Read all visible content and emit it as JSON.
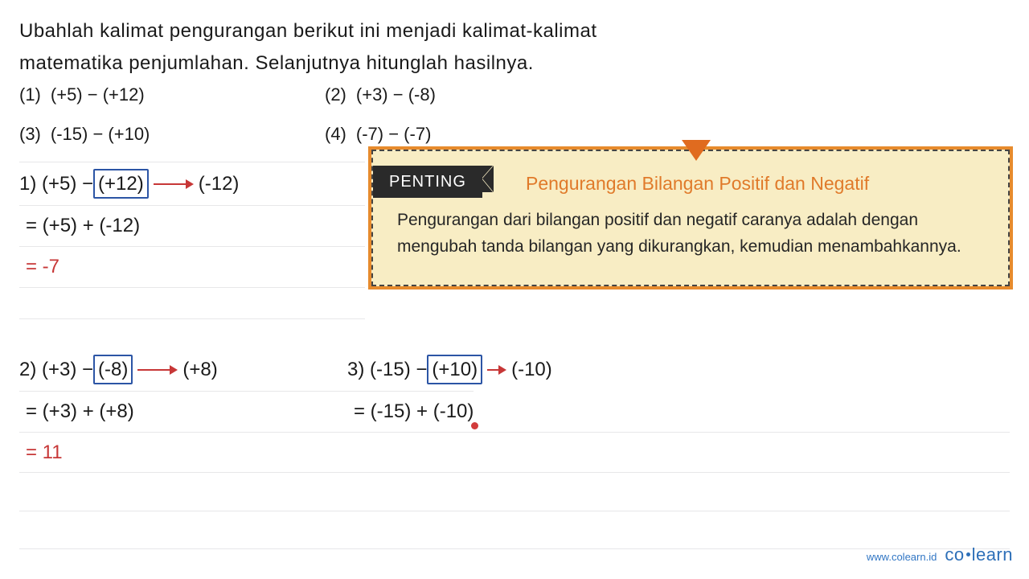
{
  "instruction": {
    "line1": "Ubahlah kalimat pengurangan berikut ini menjadi kalimat-kalimat",
    "line2": "matematika penjumlahan. Selanjutnya hitunglah hasilnya."
  },
  "problems": [
    {
      "num": "(1)",
      "expr": "(+5) − (+12)"
    },
    {
      "num": "(2)",
      "expr": "(+3) − (-8)"
    },
    {
      "num": "(3)",
      "expr": "(-15) − (+10)"
    },
    {
      "num": "(4)",
      "expr": "(-7) − (-7)"
    }
  ],
  "penting": {
    "label": "PENTING",
    "title": "Pengurangan Bilangan Positif dan Negatif",
    "body": "Pengurangan dari bilangan positif dan negatif caranya adalah dengan mengubah tanda bilangan yang dikurangkan, kemudian menambahkannya."
  },
  "solutions": {
    "s1": {
      "prefix": "1) (+5) − ",
      "boxed": "(+12)",
      "arrow_to": "(-12)",
      "step": "= (+5) + (-12)",
      "result": "= -7"
    },
    "s2": {
      "prefix": "2) (+3) − ",
      "boxed": "(-8)",
      "arrow_to": "(+8)",
      "step": "= (+3) + (+8)",
      "result": "= 11"
    },
    "s3": {
      "prefix": "3) (-15) − ",
      "boxed": "(+10)",
      "arrow_to": "(-10)",
      "step": "= (-15) + (-10)"
    }
  },
  "footer": {
    "url": "www.colearn.id",
    "brand_a": "co",
    "brand_b": "learn"
  }
}
